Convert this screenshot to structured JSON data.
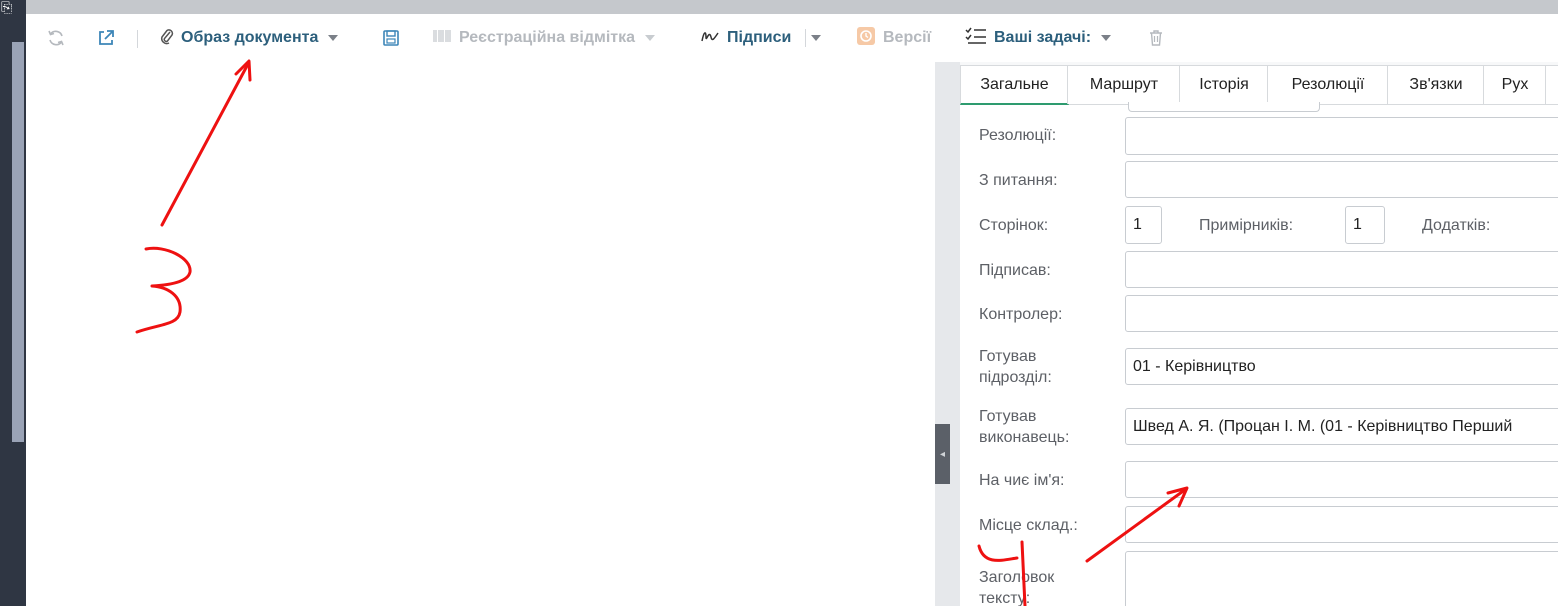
{
  "toolbar": {
    "refresh_icon": "refresh-icon",
    "open_external_icon": "external-link-icon",
    "document_image_label": "Образ документа",
    "save_icon": "save-icon",
    "registration_mark_label": "Реєстраційна відмітка",
    "signatures_label": "Підписи",
    "versions_label": "Версії",
    "tasks_label": "Ваші задачі:",
    "delete_icon": "trash-icon"
  },
  "tabs": [
    {
      "label": "Загальне",
      "active": true
    },
    {
      "label": "Маршрут"
    },
    {
      "label": "Історія"
    },
    {
      "label": "Резолюції"
    },
    {
      "label": "Зв'язки"
    },
    {
      "label": "Рух"
    }
  ],
  "form": {
    "resolutions_label": "Резолюції:",
    "resolutions_value": "",
    "subject_label": "З питання:",
    "subject_value": "",
    "pages_label": "Сторінок:",
    "pages_value": "1",
    "copies_label": "Примірників:",
    "copies_value": "1",
    "attachments_label": "Додатків:",
    "signed_by_label": "Підписав:",
    "signed_by_value": "",
    "controller_label": "Контролер:",
    "controller_value": "",
    "prepared_dept_label_1": "Готував",
    "prepared_dept_label_2": "підрозділ:",
    "prepared_dept_value": "01 - Керівництво",
    "prepared_exec_label_1": "Готував",
    "prepared_exec_label_2": "виконавець:",
    "prepared_exec_value": "Швед  А. Я. (Процан  І. М. (01 - Керівництво Перший",
    "on_behalf_label": "На чиє ім'я:",
    "on_behalf_value": "",
    "place_label": "Місце склад.:",
    "place_value": "",
    "text_title_label_1": "Заголовок",
    "text_title_label_2": "тексту:",
    "text_title_value": ""
  },
  "colors": {
    "accent": "#2c5f7c",
    "active_tab": "#2e9b6f",
    "annotation": "#ee1111",
    "sidebar": "#2f3643"
  }
}
